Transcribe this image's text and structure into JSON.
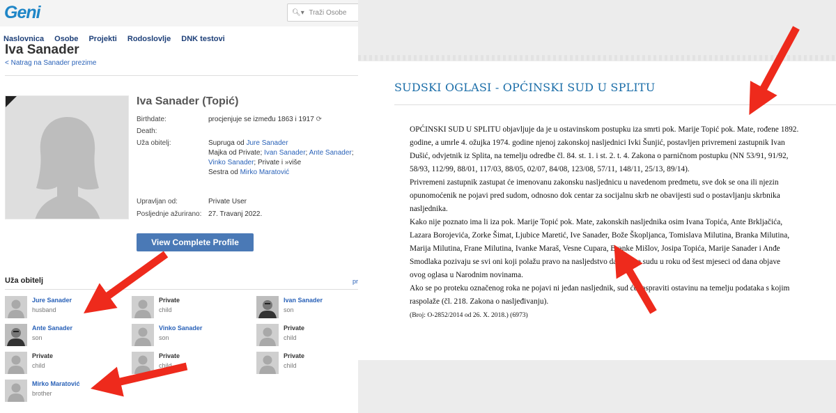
{
  "geni": {
    "logo": "Geni",
    "search_placeholder": "Traži Osobe",
    "nav": [
      "Naslovnica",
      "Osobe",
      "Projekti",
      "Rodoslovlje",
      "DNK testovi"
    ],
    "page_title": "Iva Sanader",
    "back_link": "< Natrag na Sanader prezime",
    "profile": {
      "full_name": "Iva Sanader (Topić)",
      "birthdate_label": "Birthdate:",
      "birthdate_value": "procjenjuje se između 1863 i 1917",
      "death_label": "Death:",
      "family_label": "Uža obitelj:",
      "family_lines": [
        {
          "prefix": "Supruga od ",
          "links": [
            "Jure Sanader"
          ],
          "suffix": ""
        },
        {
          "prefix": "Majka od Private; ",
          "links": [
            "Ivan Sanader",
            "Ante Sanader"
          ],
          "suffix": ";"
        },
        {
          "prefix": "",
          "links": [
            "Vinko Sanader"
          ],
          "suffix": "; Private i »više"
        },
        {
          "prefix": "Sestra od ",
          "links": [
            "Mirko Maratović"
          ],
          "suffix": ""
        }
      ],
      "managed_label": "Upravljan od:",
      "managed_value": "Private User",
      "updated_label": "Posljednje ažurirano:",
      "updated_value": "27. Travanj 2022.",
      "button": "View Complete Profile"
    },
    "family_section_title": "Uža obitelj",
    "family_section_link": "pr",
    "members": [
      {
        "name": "Jure Sanader",
        "role": "husband",
        "link": true,
        "photo": false
      },
      {
        "name": "Private",
        "role": "child",
        "link": false,
        "photo": false
      },
      {
        "name": "Ivan Sanader",
        "role": "son",
        "link": true,
        "photo": true
      },
      {
        "name": "Ante Sanader",
        "role": "son",
        "link": true,
        "photo": true
      },
      {
        "name": "Vinko Sanader",
        "role": "son",
        "link": true,
        "photo": false
      },
      {
        "name": "Private",
        "role": "child",
        "link": false,
        "photo": false
      },
      {
        "name": "Private",
        "role": "child",
        "link": false,
        "photo": false
      },
      {
        "name": "Private",
        "role": "child",
        "link": false,
        "photo": false
      },
      {
        "name": "Private",
        "role": "child",
        "link": false,
        "photo": false
      },
      {
        "name": "Mirko Maratović",
        "role": "brother",
        "link": true,
        "photo": false
      }
    ]
  },
  "notice": {
    "title": "SUDSKI OGLASI - OPĆINSKI SUD U SPLITU",
    "lines": [
      "OPĆINSKI SUD U SPLITU objavljuje da je u ostavinskom postupku iza smrti pok. Marije Topić pok. Mate, rođene 1892.",
      "godine, a umrle 4. ožujka 1974. godine njenoj zakonskoj nasljednici Ivki Šunjić, postavljen privremeni zastupnik Ivan",
      "Dušić, odvjetnik iz Splita, na temelju odredbe čl. 84. st. 1. i st. 2. t. 4. Zakona o parničnom postupku (NN 53/91, 91/92,",
      "58/93, 112/99, 88/01, 117/03, 88/05, 02/07, 84/08, 123/08, 57/11, 148/11, 25/13, 89/14).",
      "Privremeni zastupnik zastupat će imenovanu zakonsku nasljednicu u navedenom predmetu, sve dok se ona ili njezin",
      "opunomoćenik ne pojavi pred sudom, odnosno dok centar za socijalnu skrb ne obavijesti sud o postavljanju skrbnika",
      "nasljednika.",
      "Kako nije poznato ima li iza pok. Marije Topić pok. Mate, zakonskih nasljednika osim Ivana Topića, Ante Brkljačića,",
      "Lazara Borojevića, Zorke Šimat, Ljubice Maretić, Ive Sanader, Bože Škopljanca, Tomislava Milutina, Branka Milutina,",
      "Marija Milutina, Frane Milutina, Ivanke Maraš, Vesne Cupara, Branke Mišlov, Josipa Topića, Marije Sanader i Anđe",
      "Smodlaka pozivaju se svi oni koji polažu pravo na nasljedstvo da prijave sudu u roku od šest mjeseci od dana objave",
      "ovog oglasa u Narodnim novinama.",
      "Ako se po proteku označenog roka ne pojavi ni jedan nasljednik, sud će raspraviti ostavinu na temelju podataka s kojim",
      "raspolaže (čl. 218. Zakona o nasljeđivanju)."
    ],
    "footer": "(Broj: O-2852/2014 od 26. X. 2018.)    (6973)"
  },
  "colors": {
    "arrow": "#ee2a1c",
    "geni_blue": "#1f86c7",
    "link": "#2a62b8",
    "button": "#4a79b6",
    "notice_title": "#1a6da8"
  }
}
